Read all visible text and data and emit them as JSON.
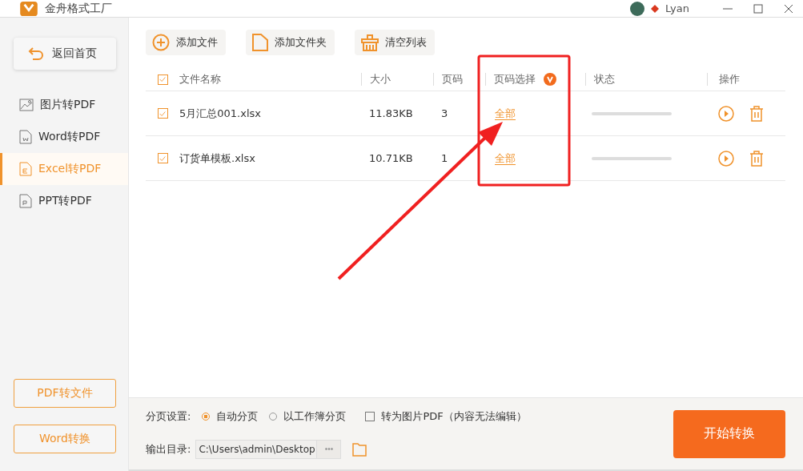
{
  "window": {
    "title": "金舟格式工厂",
    "user": "Lyan"
  },
  "sidebar": {
    "back_button": "返回首页",
    "items": [
      {
        "label": "图片转PDF",
        "kind": "image",
        "selected": false
      },
      {
        "label": "Word转PDF",
        "kind": "word",
        "selected": false
      },
      {
        "label": "Excel转PDF",
        "kind": "excel",
        "selected": true
      },
      {
        "label": "PPT转PDF",
        "kind": "ppt",
        "selected": false
      }
    ],
    "bottom_buttons": [
      "PDF转文件",
      "Word转换"
    ]
  },
  "toolbar": [
    {
      "label": "添加文件",
      "kind": "add"
    },
    {
      "label": "添加文件夹",
      "kind": "folder"
    },
    {
      "label": "清空列表",
      "kind": "clear"
    }
  ],
  "table": {
    "select_all": {
      "checked": true
    },
    "columns": [
      "文件名称",
      "大小",
      "页码",
      "页码选择",
      "状态",
      "操作"
    ],
    "rows": [
      {
        "checked": true,
        "name": "5月汇总001.xlsx",
        "size": "11.83KB",
        "pages": "3",
        "page_selection": "全部",
        "level": 0
      },
      {
        "checked": true,
        "name": "订货单模板.xlsx",
        "size": "10.71KB",
        "pages": "1",
        "page_selection": "全部",
        "level": 0
      }
    ]
  },
  "settings": {
    "split_label": "分页设置:",
    "split_options": [
      {
        "label": "自动分页",
        "selected": true
      },
      {
        "label": "以工作簿分页",
        "selected": false
      }
    ],
    "image_pdf": {
      "label": "转为图片PDF（内容无法编辑）",
      "checked": false
    },
    "output_label": "输出目录:",
    "output_path": "C:\\Users\\admin\\Desktop",
    "browse": "•••"
  },
  "start_button": "开始转换"
}
